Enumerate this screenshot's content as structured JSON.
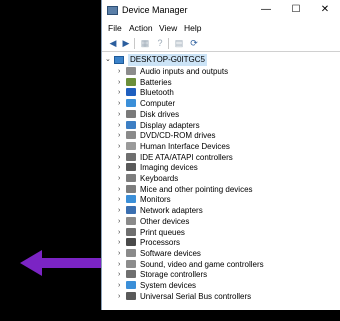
{
  "window": {
    "title": "Device Manager",
    "controls": {
      "minimize": "—",
      "maximize": "☐",
      "close": "✕"
    }
  },
  "menu": {
    "file": "File",
    "action": "Action",
    "view": "View",
    "help": "Help"
  },
  "toolbar": {
    "back": "◀",
    "forward": "▶",
    "properties": "▦",
    "help": "?",
    "update": "▤",
    "scan": "⟳"
  },
  "tree": {
    "root": "DESKTOP-G0ITGC5",
    "items": [
      {
        "label": "Audio inputs and outputs",
        "icon": "speaker-icon",
        "color": "#8c8c8c"
      },
      {
        "label": "Batteries",
        "icon": "battery-icon",
        "color": "#6b8e3a"
      },
      {
        "label": "Bluetooth",
        "icon": "bluetooth-icon",
        "color": "#1f5fbf"
      },
      {
        "label": "Computer",
        "icon": "computer-icon",
        "color": "#3b8fd8"
      },
      {
        "label": "Disk drives",
        "icon": "disk-icon",
        "color": "#7a7a7a"
      },
      {
        "label": "Display adapters",
        "icon": "display-icon",
        "color": "#3d7fc4"
      },
      {
        "label": "DVD/CD-ROM drives",
        "icon": "dvd-icon",
        "color": "#8a8a8a"
      },
      {
        "label": "Human Interface Devices",
        "icon": "hid-icon",
        "color": "#9a9a9a"
      },
      {
        "label": "IDE ATA/ATAPI controllers",
        "icon": "ide-icon",
        "color": "#6f6f6f"
      },
      {
        "label": "Imaging devices",
        "icon": "camera-icon",
        "color": "#5a5a5a"
      },
      {
        "label": "Keyboards",
        "icon": "keyboard-icon",
        "color": "#7d7d7d"
      },
      {
        "label": "Mice and other pointing devices",
        "icon": "mouse-icon",
        "color": "#7d7d7d"
      },
      {
        "label": "Monitors",
        "icon": "monitor-icon",
        "color": "#3b8fd8"
      },
      {
        "label": "Network adapters",
        "icon": "network-icon",
        "color": "#3b6fb0"
      },
      {
        "label": "Other devices",
        "icon": "other-devices-icon",
        "color": "#8a8a8a"
      },
      {
        "label": "Print queues",
        "icon": "printer-icon",
        "color": "#6f6f6f"
      },
      {
        "label": "Processors",
        "icon": "processor-icon",
        "color": "#4a4a4a"
      },
      {
        "label": "Software devices",
        "icon": "software-icon",
        "color": "#8a8a8a"
      },
      {
        "label": "Sound, video and game controllers",
        "icon": "sound-icon",
        "color": "#8c8c8c"
      },
      {
        "label": "Storage controllers",
        "icon": "storage-icon",
        "color": "#6f6f6f"
      },
      {
        "label": "System devices",
        "icon": "system-icon",
        "color": "#3b8fd8"
      },
      {
        "label": "Universal Serial Bus controllers",
        "icon": "usb-icon",
        "color": "#5a5a5a"
      }
    ]
  },
  "colors": {
    "arrow": "#7b24c4",
    "selection": "#cce4f7"
  }
}
